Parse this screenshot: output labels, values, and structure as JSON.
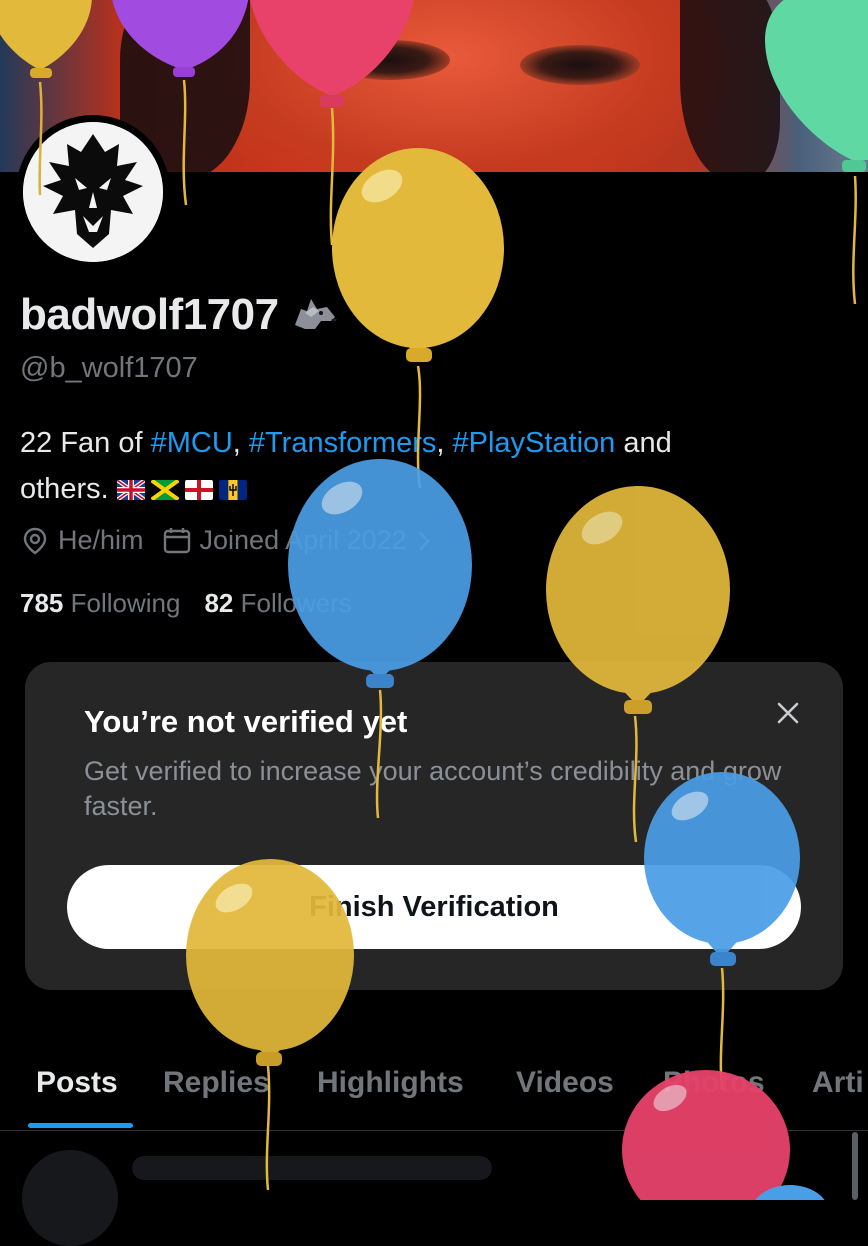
{
  "profile": {
    "display_name": "badwolf1707",
    "handle": "@b_wolf1707",
    "bio_number": "22 Fan of ",
    "hashtags": [
      "#MCU",
      "#Transformers",
      "#PlayStation"
    ],
    "bio_and": " and",
    "bio_end": "others.",
    "pronouns": "He/him",
    "joined": "Joined April 2022",
    "following_count": "785",
    "following_label": "Following",
    "followers_count": "82",
    "followers_label": "Followers"
  },
  "icons": {
    "emoji": "wolf-emoji-icon",
    "location": "location-pin-icon",
    "calendar": "calendar-icon",
    "chevron": "chevron-right-icon",
    "close": "close-icon",
    "flags": [
      "uk-flag-icon",
      "jamaica-flag-icon",
      "england-flag-icon",
      "barbados-flag-icon"
    ]
  },
  "verification_card": {
    "title": "You’re not verified yet",
    "description": "Get verified to increase your account’s credibility and grow faster.",
    "button_label": "Finish Verification"
  },
  "tabs": [
    {
      "label": "Posts",
      "active": true
    },
    {
      "label": "Replies",
      "active": false
    },
    {
      "label": "Highlights",
      "active": false
    },
    {
      "label": "Videos",
      "active": false
    },
    {
      "label": "Photos",
      "active": false
    },
    {
      "label": "Arti",
      "active": false
    }
  ],
  "colors": {
    "accent": "#1d9bf0",
    "balloon_yellow": "#e2b93b",
    "balloon_blue": "#4a9ee6",
    "balloon_red": "#e8426a",
    "balloon_purple": "#a24be0",
    "balloon_green": "#5fd8a4"
  }
}
